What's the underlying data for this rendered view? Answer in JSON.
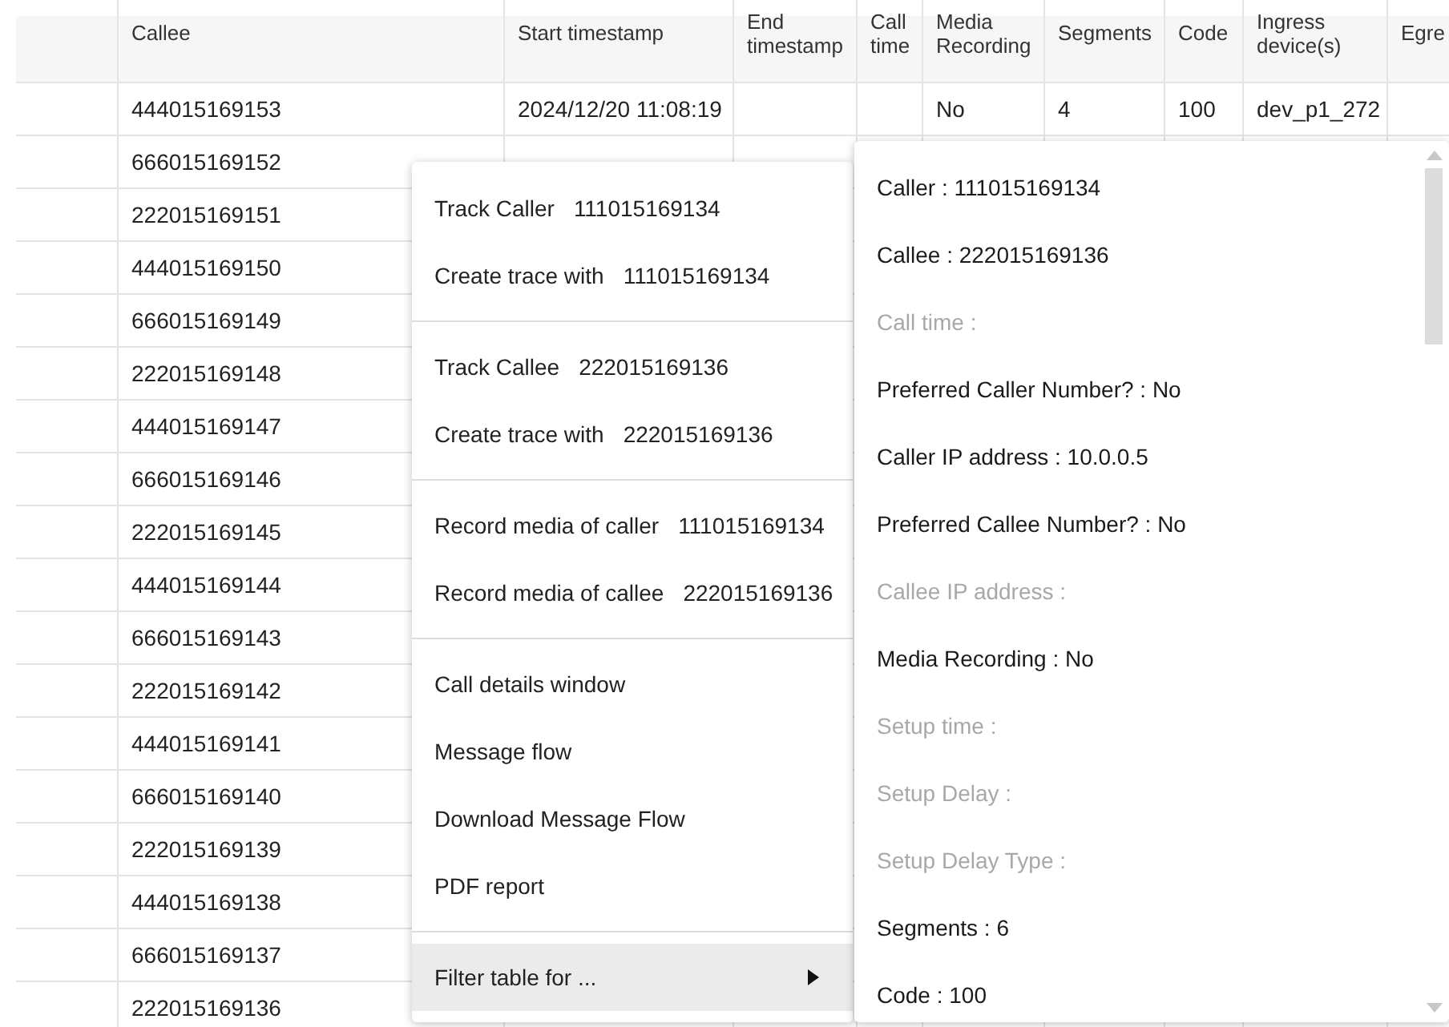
{
  "table": {
    "columns": [
      null,
      "Callee",
      "Start timestamp",
      "End timestamp",
      "Call time",
      "Media Recording",
      "Segments",
      "Code",
      "Ingress device(s)",
      "Egre"
    ],
    "rows": [
      {
        "cells": [
          null,
          "444015169153",
          "2024/12/20 11:08:19",
          null,
          null,
          "No",
          "4",
          "100",
          "dev_p1_272",
          null
        ]
      },
      {
        "cells": [
          null,
          "666015169152",
          null,
          null,
          null,
          null,
          null,
          null,
          null
        ]
      },
      {
        "cells": [
          null,
          "222015169151"
        ]
      },
      {
        "cells": [
          null,
          "444015169150"
        ]
      },
      {
        "cells": [
          null,
          "666015169149"
        ]
      },
      {
        "cells": [
          null,
          "222015169148"
        ]
      },
      {
        "cells": [
          null,
          "444015169147"
        ]
      },
      {
        "cells": [
          null,
          "666015169146"
        ]
      },
      {
        "cells": [
          null,
          "222015169145"
        ]
      },
      {
        "cells": [
          null,
          "444015169144"
        ]
      },
      {
        "cells": [
          null,
          "666015169143"
        ]
      },
      {
        "cells": [
          null,
          "222015169142"
        ]
      },
      {
        "cells": [
          null,
          "444015169141"
        ]
      },
      {
        "cells": [
          null,
          "666015169140"
        ]
      },
      {
        "cells": [
          null,
          "222015169139"
        ]
      },
      {
        "cells": [
          null,
          "444015169138"
        ]
      },
      {
        "cells": [
          null,
          "666015169137"
        ]
      },
      {
        "cells": [
          null,
          "222015169136"
        ]
      }
    ]
  },
  "context_menu": {
    "groups": [
      [
        {
          "label": "Track Caller",
          "value": "111015169134",
          "highlighted": false,
          "has_submenu": false
        },
        {
          "label": "Create trace with",
          "value": "111015169134",
          "highlighted": false,
          "has_submenu": false
        }
      ],
      [
        {
          "label": "Track Callee",
          "value": "222015169136",
          "highlighted": false,
          "has_submenu": false
        },
        {
          "label": "Create trace with",
          "value": "222015169136",
          "highlighted": false,
          "has_submenu": false
        }
      ],
      [
        {
          "label": "Record media of caller",
          "value": "111015169134",
          "highlighted": false,
          "has_submenu": false
        },
        {
          "label": "Record media of callee",
          "value": "222015169136",
          "highlighted": false,
          "has_submenu": false
        }
      ],
      [
        {
          "label": "Call details window",
          "highlighted": false,
          "has_submenu": false
        },
        {
          "label": "Message flow",
          "highlighted": false,
          "has_submenu": false
        },
        {
          "label": "Download Message Flow",
          "highlighted": false,
          "has_submenu": false
        },
        {
          "label": "PDF report",
          "highlighted": false,
          "has_submenu": false
        }
      ],
      [
        {
          "label": "Filter table for ...",
          "highlighted": true,
          "has_submenu": true
        }
      ]
    ]
  },
  "details_panel": {
    "items": [
      {
        "text": "Caller : 111015169134",
        "disabled": false
      },
      {
        "text": "Callee : 222015169136",
        "disabled": false
      },
      {
        "text": "Call time :",
        "disabled": true
      },
      {
        "text": "Preferred Caller Number? : No",
        "disabled": false
      },
      {
        "text": "Caller IP address : 10.0.0.5",
        "disabled": false
      },
      {
        "text": "Preferred Callee Number? : No",
        "disabled": false
      },
      {
        "text": "Callee IP address :",
        "disabled": true
      },
      {
        "text": "Media Recording : No",
        "disabled": false
      },
      {
        "text": "Setup time :",
        "disabled": true
      },
      {
        "text": "Setup Delay :",
        "disabled": true
      },
      {
        "text": "Setup Delay Type :",
        "disabled": true
      },
      {
        "text": "Segments : 6",
        "disabled": false
      },
      {
        "text": "Code : 100",
        "disabled": false
      }
    ]
  }
}
